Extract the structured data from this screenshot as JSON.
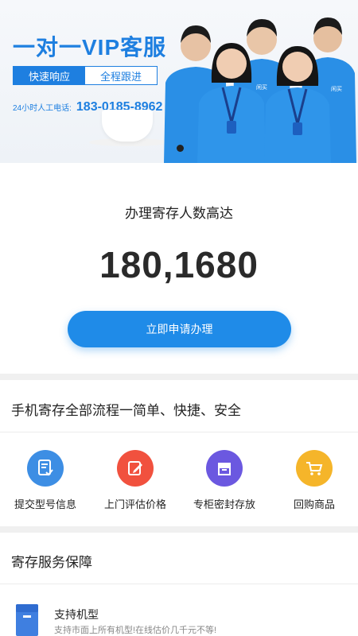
{
  "banner": {
    "title": "一对一VIP客服",
    "tag_primary": "快速响应",
    "tag_secondary": "全程跟进",
    "phone_label": "24小时人工电话:",
    "phone_number": "183-0185-8962",
    "lanyard_badge": "闲买",
    "colors": {
      "accent": "#1e7fe0",
      "shirt": "#2a8fe6"
    }
  },
  "counter": {
    "label": "办理寄存人数高达",
    "value": "180,1680"
  },
  "apply_button": {
    "label": "立即申请办理",
    "color": "#1f8be8"
  },
  "process": {
    "title": "手机寄存全部流程一简单、快捷、安全",
    "steps": [
      {
        "label": "提交型号信息",
        "icon": "document-check-icon",
        "color": "#3d8ee4"
      },
      {
        "label": "上门评估价格",
        "icon": "edit-note-icon",
        "color": "#f1513e"
      },
      {
        "label": "专柜密封存放",
        "icon": "sealed-box-icon",
        "color": "#6b58e0"
      },
      {
        "label": "回购商品",
        "icon": "shopping-cart-icon",
        "color": "#f5b52a"
      }
    ]
  },
  "service": {
    "title": "寄存服务保障",
    "items": [
      {
        "title": "支持机型",
        "desc": "支持市面上所有机型!在线估价几千元不等!",
        "icon": "storage-box-icon",
        "color": "#3f7fe0"
      }
    ]
  }
}
